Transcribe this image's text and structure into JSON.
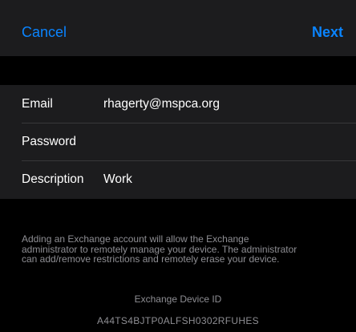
{
  "navbar": {
    "cancel_label": "Cancel",
    "next_label": "Next"
  },
  "form": {
    "email": {
      "label": "Email",
      "value": "rhagerty@mspca.org"
    },
    "password": {
      "label": "Password",
      "value": ""
    },
    "description": {
      "label": "Description",
      "value": "Work"
    }
  },
  "footer": {
    "note_lines": [
      "Adding an Exchange account will allow the Exchange",
      "administrator to remotely manage your device. The administrator",
      "can add/remove restrictions and remotely erase your device."
    ],
    "device_id_title": "Exchange Device ID",
    "device_id": "A44TS4BJTP0ALFSH0302RFUHES"
  },
  "colors": {
    "accent": "#0a84ff",
    "group_background": "#1c1c1e",
    "background": "#000000",
    "secondary_text": "#8e8e93"
  }
}
